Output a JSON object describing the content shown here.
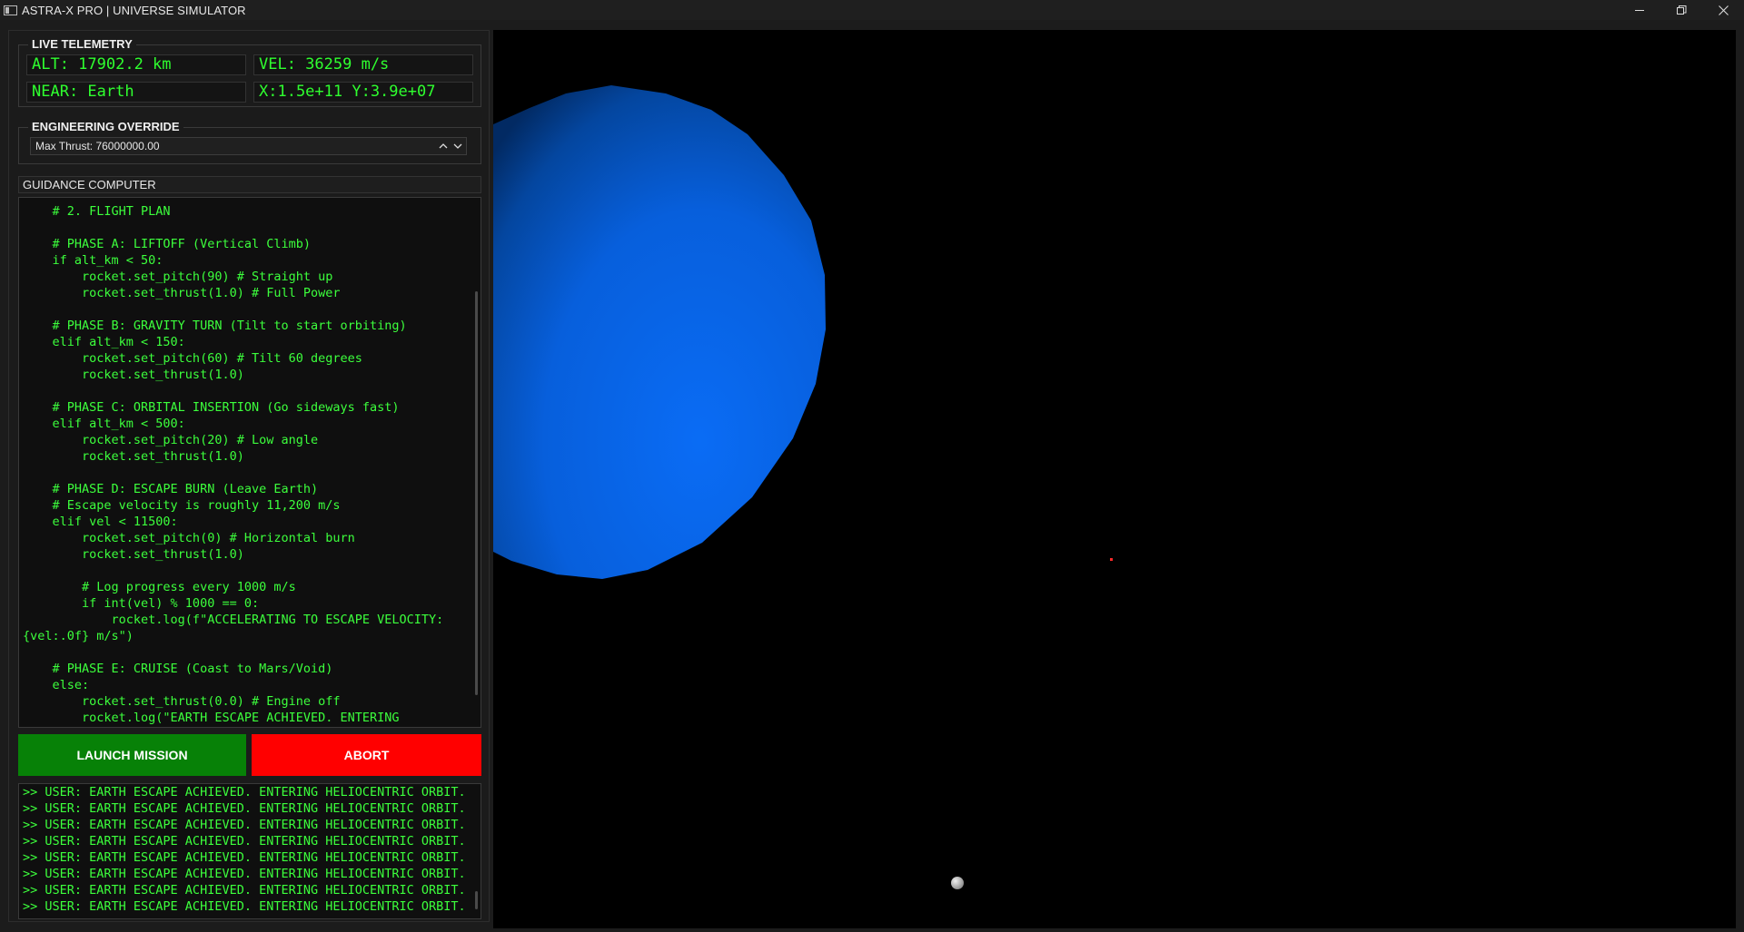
{
  "window": {
    "title": "ASTRA-X PRO | UNIVERSE SIMULATOR",
    "controls": [
      "minimize",
      "restore",
      "close"
    ]
  },
  "telemetry": {
    "section_title": "LIVE TELEMETRY",
    "altitude": "ALT: 17902.2 km",
    "velocity": "VEL: 36259 m/s",
    "nearest_body": "NEAR: Earth",
    "position": "X:1.5e+11 Y:3.9e+07",
    "text_color": "#2fff2f"
  },
  "engineering": {
    "section_title": "ENGINEERING OVERRIDE",
    "max_thrust_value": "Max Thrust: 76000000.00"
  },
  "guidance": {
    "label": "GUIDANCE COMPUTER",
    "code_lines": [
      "    # 2. FLIGHT PLAN",
      "",
      "    # PHASE A: LIFTOFF (Vertical Climb)",
      "    if alt_km < 50:",
      "        rocket.set_pitch(90) # Straight up",
      "        rocket.set_thrust(1.0) # Full Power",
      "",
      "    # PHASE B: GRAVITY TURN (Tilt to start orbiting)",
      "    elif alt_km < 150:",
      "        rocket.set_pitch(60) # Tilt 60 degrees",
      "        rocket.set_thrust(1.0)",
      "",
      "    # PHASE C: ORBITAL INSERTION (Go sideways fast)",
      "    elif alt_km < 500:",
      "        rocket.set_pitch(20) # Low angle",
      "        rocket.set_thrust(1.0)",
      "",
      "    # PHASE D: ESCAPE BURN (Leave Earth)",
      "    # Escape velocity is roughly 11,200 m/s",
      "    elif vel < 11500:",
      "        rocket.set_pitch(0) # Horizontal burn",
      "        rocket.set_thrust(1.0)",
      "",
      "        # Log progress every 1000 m/s",
      "        if int(vel) % 1000 == 0:",
      "            rocket.log(f\"ACCELERATING TO ESCAPE VELOCITY:",
      "{vel:.0f} m/s\")",
      "",
      "    # PHASE E: CRUISE (Coast to Mars/Void)",
      "    else:",
      "        rocket.set_thrust(0.0) # Engine off",
      "        rocket.log(\"EARTH ESCAPE ACHIEVED. ENTERING"
    ],
    "code_color": "#3cff3c"
  },
  "buttons": {
    "launch_label": "LAUNCH MISSION",
    "launch_color": "#078107",
    "abort_label": "ABORT",
    "abort_color": "#ff0000"
  },
  "console": {
    "lines": [
      ">> USER: EARTH ESCAPE ACHIEVED. ENTERING HELIOCENTRIC ORBIT.",
      ">> USER: EARTH ESCAPE ACHIEVED. ENTERING HELIOCENTRIC ORBIT.",
      ">> USER: EARTH ESCAPE ACHIEVED. ENTERING HELIOCENTRIC ORBIT.",
      ">> USER: EARTH ESCAPE ACHIEVED. ENTERING HELIOCENTRIC ORBIT.",
      ">> USER: EARTH ESCAPE ACHIEVED. ENTERING HELIOCENTRIC ORBIT.",
      ">> USER: EARTH ESCAPE ACHIEVED. ENTERING HELIOCENTRIC ORBIT.",
      ">> USER: EARTH ESCAPE ACHIEVED. ENTERING HELIOCENTRIC ORBIT.",
      ">> USER: EARTH ESCAPE ACHIEVED. ENTERING HELIOCENTRIC ORBIT."
    ]
  },
  "scene": {
    "background": "#000000",
    "planet_color": "#0a66ee",
    "rocket_marker_color": "#ff2a2a",
    "moon_color": "#c8c8c8"
  }
}
